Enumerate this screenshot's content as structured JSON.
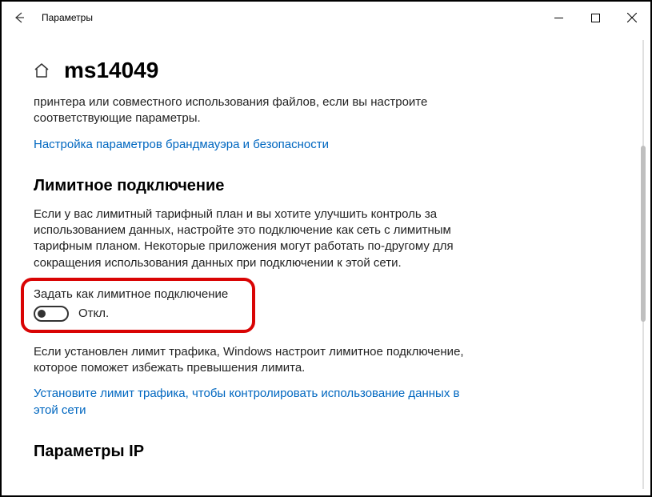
{
  "window": {
    "title": "Параметры"
  },
  "header": {
    "title": "ms14049"
  },
  "intro": {
    "paragraph": "принтера или совместного использования файлов, если вы настроите соответствующие параметры.",
    "link": "Настройка параметров брандмауэра и безопасности"
  },
  "metered": {
    "heading": "Лимитное подключение",
    "description": "Если у вас лимитный тарифный план и вы хотите улучшить контроль за использованием данных, настройте это подключение как сеть с лимитным тарифным планом. Некоторые приложения могут работать по-другому для сокращения использования данных при подключении к этой сети.",
    "toggle_label": "Задать как лимитное подключение",
    "toggle_state": "Откл.",
    "after_text": "Если установлен лимит трафика, Windows настроит лимитное подключение, которое поможет избежать превышения лимита.",
    "link": "Установите лимит трафика, чтобы контролировать использование данных в этой сети"
  },
  "ip": {
    "heading": "Параметры IP"
  }
}
